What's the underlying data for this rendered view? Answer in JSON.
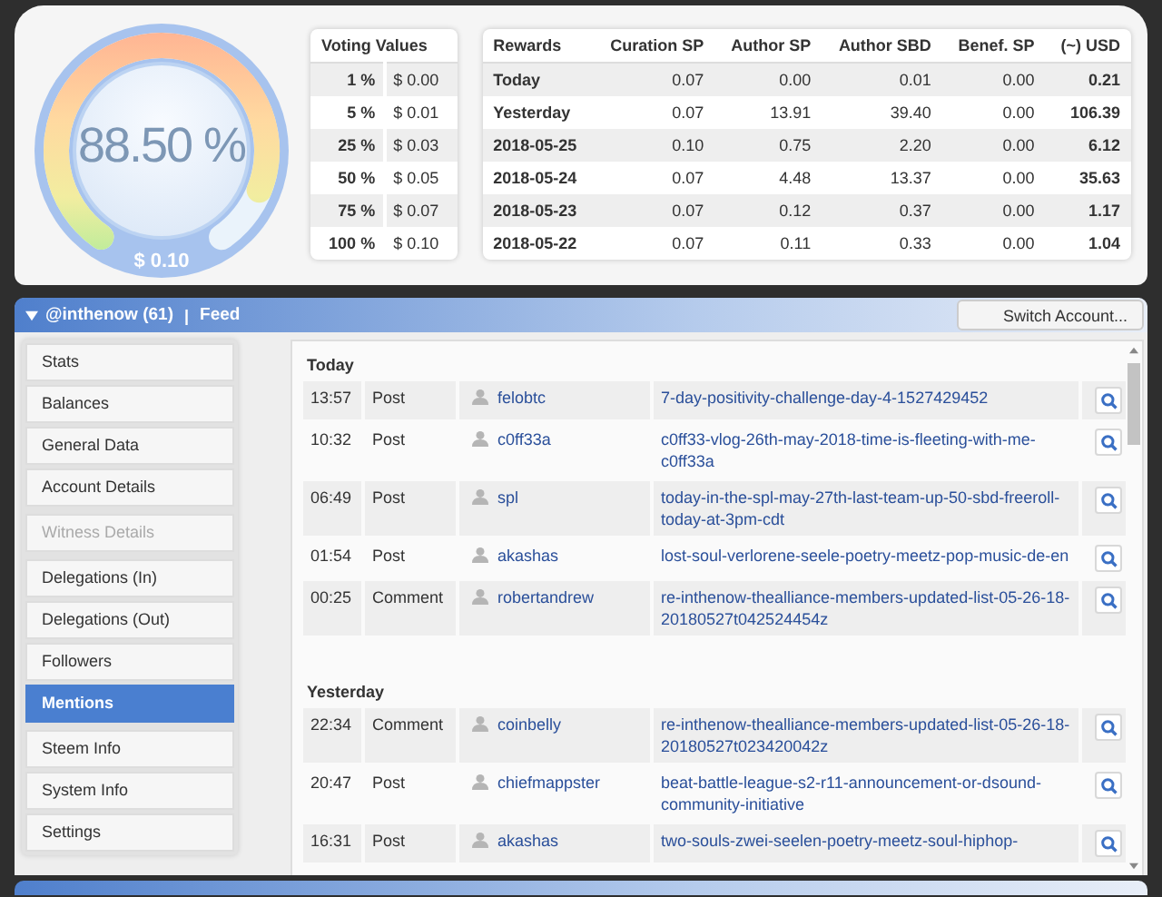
{
  "gauge": {
    "percent": "88.50 %",
    "value": "$ 0.10"
  },
  "voting": {
    "title": "Voting Values",
    "rows": [
      {
        "pct": "1 %",
        "usd": "$ 0.00"
      },
      {
        "pct": "5 %",
        "usd": "$ 0.01"
      },
      {
        "pct": "25 %",
        "usd": "$ 0.03"
      },
      {
        "pct": "50 %",
        "usd": "$ 0.05"
      },
      {
        "pct": "75 %",
        "usd": "$ 0.07"
      },
      {
        "pct": "100 %",
        "usd": "$ 0.10"
      }
    ]
  },
  "rewards": {
    "columns": [
      "Rewards",
      "Curation SP",
      "Author SP",
      "Author SBD",
      "Benef. SP",
      "(~) USD"
    ],
    "rows": [
      [
        "Today",
        "0.07",
        "0.00",
        "0.01",
        "0.00",
        "0.21"
      ],
      [
        "Yesterday",
        "0.07",
        "13.91",
        "39.40",
        "0.00",
        "106.39"
      ],
      [
        "2018-05-25",
        "0.10",
        "0.75",
        "2.20",
        "0.00",
        "6.12"
      ],
      [
        "2018-05-24",
        "0.07",
        "4.48",
        "13.37",
        "0.00",
        "35.63"
      ],
      [
        "2018-05-23",
        "0.07",
        "0.12",
        "0.37",
        "0.00",
        "1.17"
      ],
      [
        "2018-05-22",
        "0.07",
        "0.11",
        "0.33",
        "0.00",
        "1.04"
      ]
    ]
  },
  "account_panel": {
    "account": "@inthenow (61)",
    "separator": "|",
    "section": "Feed",
    "switch_button": "Switch Account..."
  },
  "sidebar": {
    "groups": [
      {
        "items": [
          {
            "label": "Stats",
            "selected": false,
            "disabled": false
          },
          {
            "label": "Balances",
            "selected": false,
            "disabled": false
          },
          {
            "label": "General Data",
            "selected": false,
            "disabled": false
          },
          {
            "label": "Account Details",
            "selected": false,
            "disabled": false
          }
        ]
      },
      {
        "items": [
          {
            "label": "Witness Details",
            "selected": false,
            "disabled": true
          }
        ]
      },
      {
        "items": [
          {
            "label": "Delegations (In)",
            "selected": false,
            "disabled": false
          },
          {
            "label": "Delegations (Out)",
            "selected": false,
            "disabled": false
          },
          {
            "label": "Followers",
            "selected": false,
            "disabled": false
          },
          {
            "label": "Mentions",
            "selected": true,
            "disabled": false
          }
        ]
      },
      {
        "items": [
          {
            "label": "Steem Info",
            "selected": false,
            "disabled": false
          },
          {
            "label": "System Info",
            "selected": false,
            "disabled": false
          },
          {
            "label": "Settings",
            "selected": false,
            "disabled": false
          }
        ]
      }
    ]
  },
  "feed": {
    "sections": [
      {
        "title": "Today",
        "rows": [
          {
            "time": "13:57",
            "type": "Post",
            "user": "felobtc",
            "post": "7-day-positivity-challenge-day-4-1527429452"
          },
          {
            "time": "10:32",
            "type": "Post",
            "user": "c0ff33a",
            "post": "c0ff33-vlog-26th-may-2018-time-is-fleeting-with-me-c0ff33a"
          },
          {
            "time": "06:49",
            "type": "Post",
            "user": "spl",
            "post": "today-in-the-spl-may-27th-last-team-up-50-sbd-freeroll-today-at-3pm-cdt"
          },
          {
            "time": "01:54",
            "type": "Post",
            "user": "akashas",
            "post": "lost-soul-verlorene-seele-poetry-meetz-pop-music-de-en"
          },
          {
            "time": "00:25",
            "type": "Comment",
            "user": "robertandrew",
            "post": "re-inthenow-thealliance-members-updated-list-05-26-18-20180527t042524454z"
          }
        ]
      },
      {
        "title": "Yesterday",
        "rows": [
          {
            "time": "22:34",
            "type": "Comment",
            "user": "coinbelly",
            "post": "re-inthenow-thealliance-members-updated-list-05-26-18-20180527t023420042z"
          },
          {
            "time": "20:47",
            "type": "Post",
            "user": "chiefmappster",
            "post": "beat-battle-league-s2-r11-announcement-or-dsound-community-initiative"
          },
          {
            "time": "16:31",
            "type": "Post",
            "user": "akashas",
            "post": "two-souls-zwei-seelen-poetry-meetz-soul-hiphop-"
          }
        ]
      }
    ]
  }
}
